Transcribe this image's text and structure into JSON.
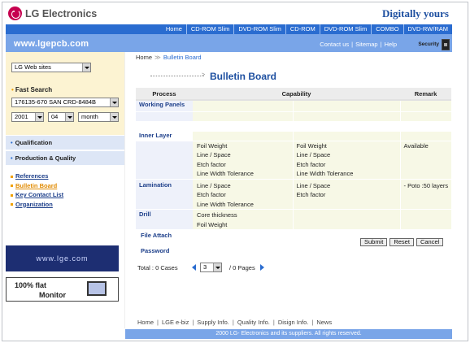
{
  "header": {
    "logo_text": "LG Electronics",
    "slogan": "Digitally yours",
    "nav": [
      "Home",
      "CD-ROM Slim",
      "DVD-ROM Slim",
      "CD-ROM",
      "DVD-ROM Slim",
      "COMBO",
      "DVD-RW/RAM"
    ],
    "site_url": "www.lgepcb.com",
    "util_links": [
      "Contact us",
      "Sitemap",
      "Help"
    ],
    "security_label": "Security"
  },
  "sidebar": {
    "web_sites_select": "LG Web sites",
    "fast_search_label": "Fast Search",
    "product_select": "176135-670 SAN CRD-8484B",
    "year_select": "2001",
    "day_select": "04",
    "month_select": "month",
    "menu": [
      "Qualification",
      "Production & Quality"
    ],
    "links": [
      "References",
      "Bulletin Board",
      "Key Contact List",
      "Organization"
    ],
    "banner1": "www.lge.com",
    "banner2_line1": "100% flat",
    "banner2_line2": "Monitor"
  },
  "main": {
    "breadcrumb_home": "Home",
    "breadcrumb_current": "Bulletin Board",
    "title": "Bulletin Board",
    "columns": [
      "Process",
      "Capability",
      "Remark"
    ],
    "rows": {
      "working_panels": "Working Panels",
      "inner_layer": "Inner Layer",
      "inner_c1": [
        "Foil Weight",
        "Line / Space",
        "Etch factor",
        "Line Width Tolerance"
      ],
      "inner_c2": [
        "Foil Weight",
        "Line / Space",
        "Etch factor",
        "Line Width Tolerance"
      ],
      "inner_c3": "Available",
      "lamination": "Lamination",
      "lam_c1": [
        "Line / Space",
        "Etch factor",
        "Line Width Tolerance"
      ],
      "lam_c2": [
        "Line / Space",
        "Etch factor"
      ],
      "lam_c3": "- Poto :50 layers",
      "drill": "Drill",
      "drill_c1": [
        "Core thickness",
        "Foil Weight"
      ],
      "file_attach": "File Attach",
      "password": "Password"
    },
    "buttons": {
      "submit": "Submit",
      "reset": "Reset",
      "cancel": "Cancel"
    },
    "total": "Total : 0 Cases",
    "page_select": "3",
    "pages_text": "/ 0 Pages"
  },
  "footer": {
    "links": [
      "Home",
      "LGE e-biz",
      "Supply Info.",
      "Quality Info.",
      "Disign Info.",
      "News"
    ],
    "copyright": "2000 LG- Electronics and its suppliers. All rights reserved."
  }
}
